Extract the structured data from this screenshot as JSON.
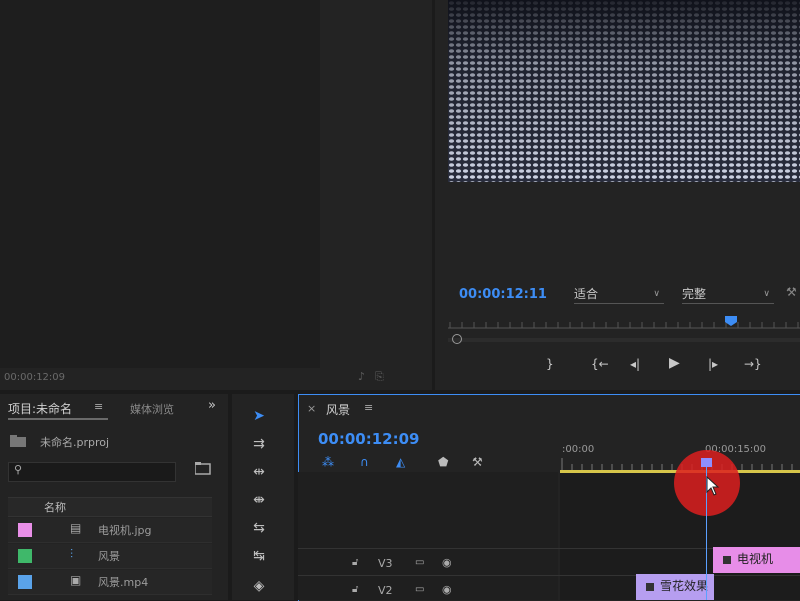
{
  "source": {
    "timecode": "00:00:12:09"
  },
  "program": {
    "timecode": "00:00:12:11",
    "zoom": "适合",
    "quality": "完整",
    "transport": {
      "mark_out": "}",
      "go_in": "{←",
      "step_back": "◂|",
      "play": "▶",
      "step_fwd": "|▸",
      "go_out": "→}"
    }
  },
  "project": {
    "tab": "项目:未命名",
    "media_browser": "媒体浏览",
    "file": "未命名.prproj",
    "col_name": "名称",
    "items": [
      {
        "label": "电视机.jpg",
        "color": "#e98fe8"
      },
      {
        "label": "风景",
        "color": "#3fb86a"
      },
      {
        "label": "风景.mp4",
        "color": "#5aa3ea"
      }
    ]
  },
  "timeline": {
    "sequence": "风景",
    "timecode": "00:00:12:09",
    "ruler": [
      ":00:00",
      "00:00:15:00"
    ],
    "tracks": [
      {
        "name": "V3"
      },
      {
        "name": "V2"
      }
    ],
    "clips": {
      "tv": "电视机",
      "snow": "雪花效果"
    }
  },
  "colors": {
    "accent": "#3d8df5",
    "work_area": "#d6c54a",
    "click": "#dc1e1e"
  }
}
